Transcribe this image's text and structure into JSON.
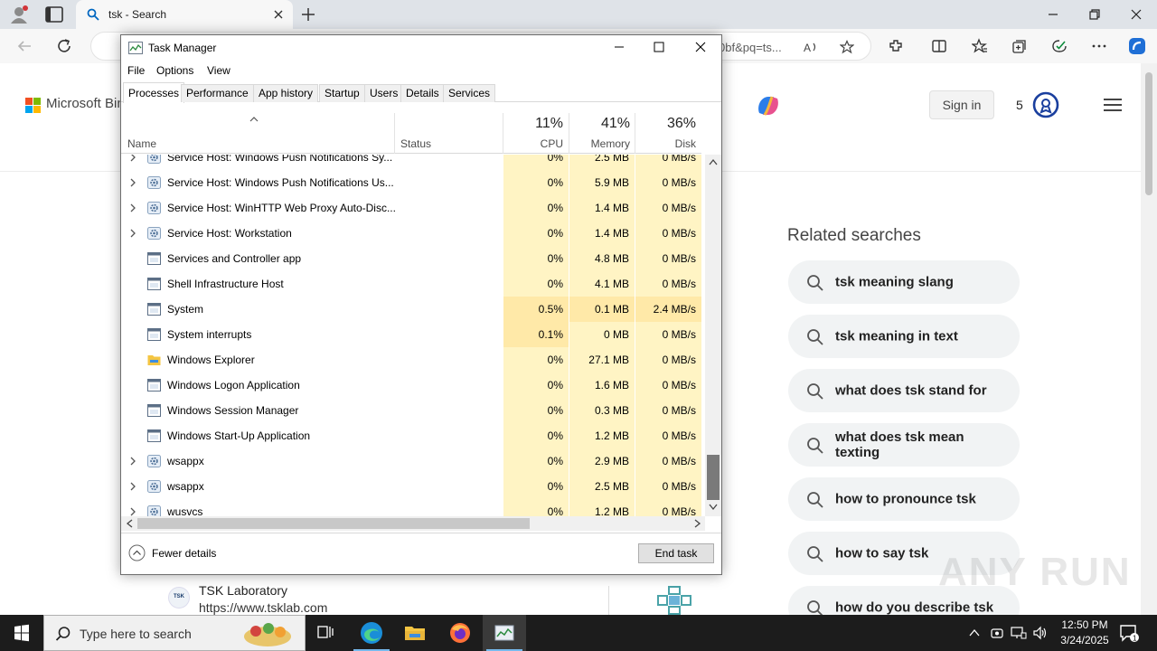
{
  "browser": {
    "tab_title": "tsk - Search",
    "url_fragment": "0bf&pq=ts..."
  },
  "bing": {
    "logo_text": "Microsoft Bing",
    "signin_label": "Sign in",
    "rewards_points": "5",
    "related_title": "Related searches",
    "related": [
      "tsk meaning slang",
      "tsk meaning in text",
      "what does tsk stand for",
      "what does tsk mean texting",
      "how to pronounce tsk",
      "how to say tsk",
      "how do you describe tsk"
    ],
    "result": {
      "favicon_text": "TSK",
      "name": "TSK Laboratory",
      "url": "https://www.tsklab.com"
    },
    "watermark": "ANY RUN"
  },
  "taskmanager": {
    "title": "Task Manager",
    "menus": [
      "File",
      "Options",
      "View"
    ],
    "tabs": [
      "Processes",
      "Performance",
      "App history",
      "Startup",
      "Users",
      "Details",
      "Services"
    ],
    "active_tab": "Processes",
    "columns": {
      "name": "Name",
      "status": "Status",
      "cpu": {
        "pct": "11%",
        "label": "CPU"
      },
      "memory": {
        "pct": "41%",
        "label": "Memory"
      },
      "disk": {
        "pct": "36%",
        "label": "Disk"
      }
    },
    "rows": [
      {
        "name": "Service Host: Windows Push Notifications Sy...",
        "cpu": "0%",
        "mem": "2.5 MB",
        "disk": "0 MB/s",
        "expandable": true,
        "icon": "gear"
      },
      {
        "name": "Service Host: Windows Push Notifications Us...",
        "cpu": "0%",
        "mem": "5.9 MB",
        "disk": "0 MB/s",
        "expandable": true,
        "icon": "gear"
      },
      {
        "name": "Service Host: WinHTTP Web Proxy Auto-Disc...",
        "cpu": "0%",
        "mem": "1.4 MB",
        "disk": "0 MB/s",
        "expandable": true,
        "icon": "gear"
      },
      {
        "name": "Service Host: Workstation",
        "cpu": "0%",
        "mem": "1.4 MB",
        "disk": "0 MB/s",
        "expandable": true,
        "icon": "gear"
      },
      {
        "name": "Services and Controller app",
        "cpu": "0%",
        "mem": "4.8 MB",
        "disk": "0 MB/s",
        "expandable": false,
        "icon": "window"
      },
      {
        "name": "Shell Infrastructure Host",
        "cpu": "0%",
        "mem": "4.1 MB",
        "disk": "0 MB/s",
        "expandable": false,
        "icon": "window"
      },
      {
        "name": "System",
        "cpu": "0.5%",
        "mem": "0.1 MB",
        "disk": "2.4 MB/s",
        "expandable": false,
        "icon": "window",
        "hot": true
      },
      {
        "name": "System interrupts",
        "cpu": "0.1%",
        "mem": "0 MB",
        "disk": "0 MB/s",
        "expandable": false,
        "icon": "window",
        "hot_cpu": true
      },
      {
        "name": "Windows Explorer",
        "cpu": "0%",
        "mem": "27.1 MB",
        "disk": "0 MB/s",
        "expandable": false,
        "icon": "folder"
      },
      {
        "name": "Windows Logon Application",
        "cpu": "0%",
        "mem": "1.6 MB",
        "disk": "0 MB/s",
        "expandable": false,
        "icon": "window"
      },
      {
        "name": "Windows Session Manager",
        "cpu": "0%",
        "mem": "0.3 MB",
        "disk": "0 MB/s",
        "expandable": false,
        "icon": "window"
      },
      {
        "name": "Windows Start-Up Application",
        "cpu": "0%",
        "mem": "1.2 MB",
        "disk": "0 MB/s",
        "expandable": false,
        "icon": "window"
      },
      {
        "name": "wsappx",
        "cpu": "0%",
        "mem": "2.9 MB",
        "disk": "0 MB/s",
        "expandable": true,
        "icon": "gear"
      },
      {
        "name": "wsappx",
        "cpu": "0%",
        "mem": "2.5 MB",
        "disk": "0 MB/s",
        "expandable": true,
        "icon": "gear"
      },
      {
        "name": "wusvcs",
        "cpu": "0%",
        "mem": "1.2 MB",
        "disk": "0 MB/s",
        "expandable": true,
        "icon": "gear"
      }
    ],
    "fewer_details": "Fewer details",
    "end_task": "End task"
  },
  "taskbar": {
    "search_placeholder": "Type here to search",
    "time": "12:50 PM",
    "date": "3/24/2025"
  },
  "colors": {
    "cell_bg": "#fff4c4",
    "cell_hot": "#ffe9a8",
    "accent_blue": "#0067c0",
    "taskbar": "#1c1c1c"
  }
}
